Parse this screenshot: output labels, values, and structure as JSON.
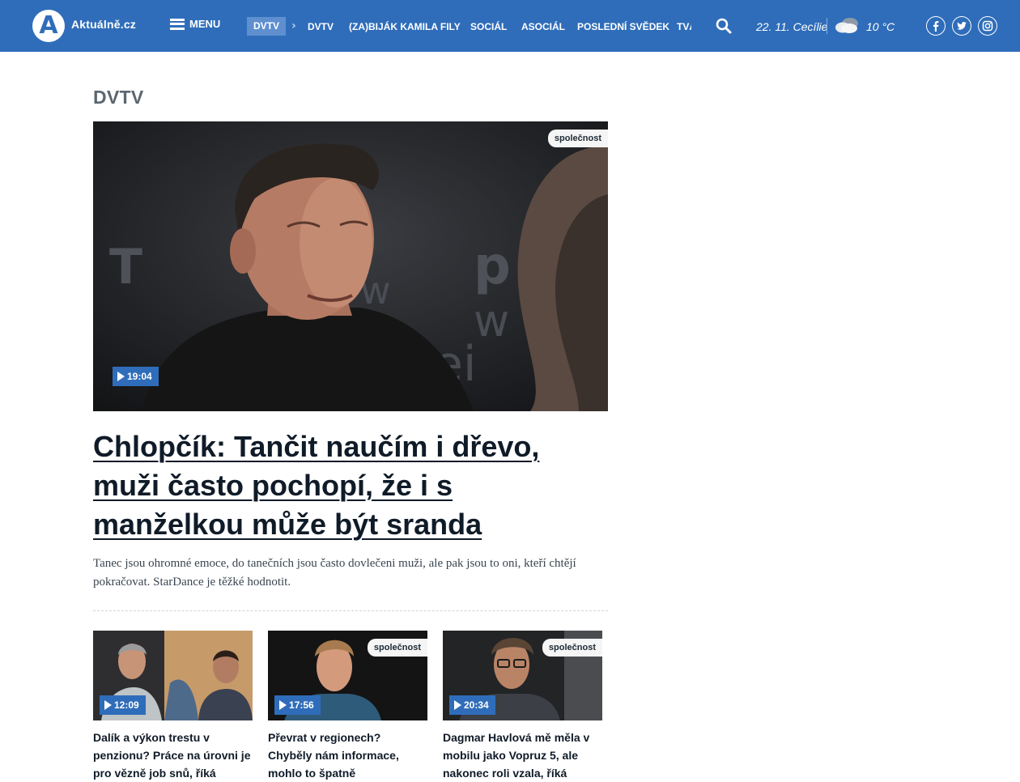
{
  "header": {
    "logo_letter": "A",
    "logo_text": "Aktuálně.cz",
    "menu_label": "MENU",
    "nav_active": "DVTV",
    "nav_items": [
      "DVTV",
      "(ZA)BIJÁK KAMILA FILY",
      "SOCIÁL",
      "ASOCIÁL",
      "POSLEDNÍ SVĚDEK"
    ],
    "nav_clipped": "TVÁŘE",
    "date": "22. 11. Cecílie",
    "temperature": "10 °C",
    "social": [
      "facebook-icon",
      "twitter-icon",
      "instagram-icon"
    ]
  },
  "section_title": "DVTV",
  "hero": {
    "tag": "společnost",
    "duration": "19:04",
    "headline": "Chlopčík: Tančit naučím i dřevo, muži často pochopí, že i s manželkou může být sranda",
    "perex": "Tanec jsou ohromné emoce, do tanečních jsou často dovlečeni muži, ale pak jsou to oni, kteří chtějí pokračovat. StarDance je těžké hodnotit."
  },
  "cards": [
    {
      "tag": "",
      "duration": "12:09",
      "title": "Dalík a výkon trestu v penzionu? Práce na úrovni je pro vězně job snů, říká"
    },
    {
      "tag": "společnost",
      "duration": "17:56",
      "title": "Převrat v regionech? Chyběly nám informace, mohlo to špatně"
    },
    {
      "tag": "společnost",
      "duration": "20:34",
      "title": "Dagmar Havlová mě měla v mobilu jako Vopruz 5, ale nakonec roli vzala, říká"
    }
  ],
  "colors": {
    "brand": "#2f6dba",
    "headline": "#101b28"
  }
}
